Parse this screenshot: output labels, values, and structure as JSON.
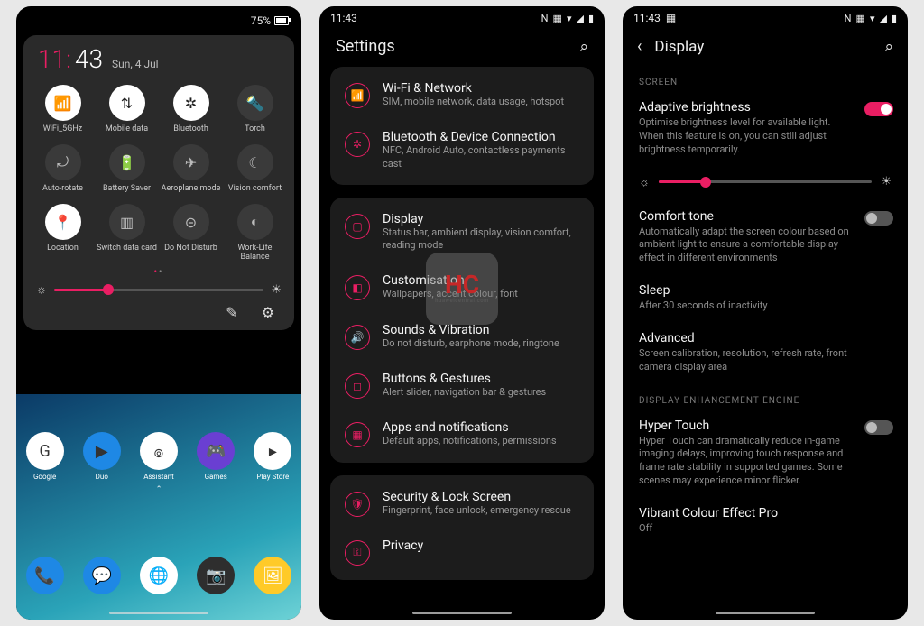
{
  "accent": "#e91e63",
  "qs": {
    "battery_pct": "75%",
    "time_h": "11:",
    "time_m": "43",
    "date": "Sun, 4 Jul",
    "brightness_pct": 26,
    "tiles": [
      {
        "label": "WiFi_5GHz",
        "on": true
      },
      {
        "label": "Mobile data",
        "on": true
      },
      {
        "label": "Bluetooth",
        "on": true
      },
      {
        "label": "Torch",
        "on": false
      },
      {
        "label": "Auto-rotate",
        "on": false
      },
      {
        "label": "Battery Saver",
        "on": false
      },
      {
        "label": "Aeroplane mode",
        "on": false
      },
      {
        "label": "Vision comfort",
        "on": false
      },
      {
        "label": "Location",
        "on": true
      },
      {
        "label": "Switch data card",
        "on": false
      },
      {
        "label": "Do Not Disturb",
        "on": false
      },
      {
        "label": "Work-Life Balance",
        "on": false
      }
    ],
    "apps_top": [
      {
        "label": "Google",
        "bg": "#fff",
        "glyph": "G"
      },
      {
        "label": "Duo",
        "bg": "#1e88e5",
        "glyph": "▶"
      },
      {
        "label": "Assistant",
        "bg": "#fff",
        "glyph": "๏"
      },
      {
        "label": "Games",
        "bg": "#6a3fd2",
        "glyph": "🎮"
      },
      {
        "label": "Play Store",
        "bg": "#fff",
        "glyph": "▸"
      }
    ],
    "apps_dock": [
      {
        "bg": "#1e88e5",
        "glyph": "📞"
      },
      {
        "bg": "#1e88e5",
        "glyph": "💬"
      },
      {
        "bg": "#ffffff",
        "glyph": "🌐"
      },
      {
        "bg": "#2e2e2e",
        "glyph": "📷"
      },
      {
        "bg": "#ffca28",
        "glyph": "🖼"
      }
    ]
  },
  "settings": {
    "statusbar_time": "11:43",
    "title": "Settings",
    "groups": [
      {
        "items": [
          {
            "title": "Wi-Fi & Network",
            "sub": "SIM, mobile network, data usage, hotspot"
          },
          {
            "title": "Bluetooth & Device Connection",
            "sub": "NFC, Android Auto, contactless payments cast"
          }
        ]
      },
      {
        "items": [
          {
            "title": "Display",
            "sub": "Status bar, ambient display, vision comfort, reading mode"
          },
          {
            "title": "Customisation",
            "sub": "Wallpapers, accent colour, font"
          },
          {
            "title": "Sounds & Vibration",
            "sub": "Do not disturb, earphone mode, ringtone"
          },
          {
            "title": "Buttons & Gestures",
            "sub": "Alert slider, navigation bar & gestures"
          },
          {
            "title": "Apps and notifications",
            "sub": "Default apps, notifications, permissions"
          }
        ]
      },
      {
        "items": [
          {
            "title": "Security & Lock Screen",
            "sub": "Fingerprint, face unlock, emergency rescue"
          },
          {
            "title": "Privacy",
            "sub": ""
          }
        ]
      }
    ]
  },
  "display": {
    "statusbar_time": "11:43",
    "title": "Display",
    "sections": [
      {
        "label": "SCREEN",
        "options": [
          {
            "title": "Adaptive brightness",
            "sub": "Optimise brightness level for available light. When this feature is on, you can still adjust brightness temporarily.",
            "toggle": true,
            "value": true
          },
          {
            "brightness_slider": true,
            "value_pct": 22
          },
          {
            "title": "Comfort tone",
            "sub": "Automatically adapt the screen colour based on ambient light to ensure a comfortable display effect in different environments",
            "toggle": true,
            "value": false
          },
          {
            "title": "Sleep",
            "sub": "After 30 seconds of inactivity"
          },
          {
            "title": "Advanced",
            "sub": "Screen calibration, resolution, refresh rate, front camera display area"
          }
        ]
      },
      {
        "label": "DISPLAY ENHANCEMENT ENGINE",
        "options": [
          {
            "title": "Hyper Touch",
            "sub": "Hyper Touch can dramatically reduce in-game imaging delays, improving touch response and frame rate stability in supported games. Some scenes may experience minor flicker.",
            "toggle": true,
            "value": false
          },
          {
            "title": "Vibrant Colour Effect Pro",
            "sub": "Off"
          }
        ]
      }
    ]
  }
}
